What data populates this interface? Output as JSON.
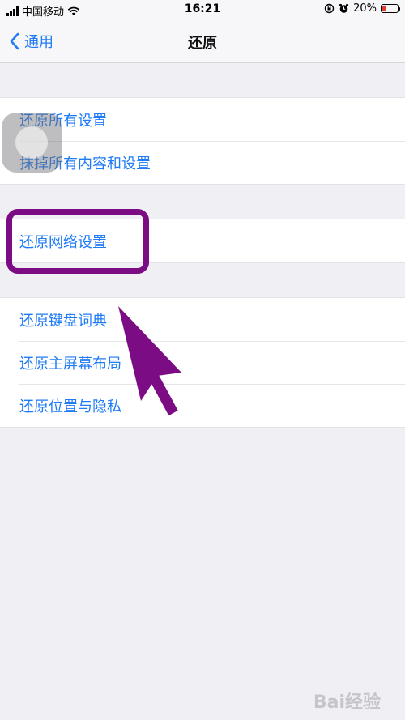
{
  "status_bar": {
    "carrier": "中国移动",
    "time": "16:21",
    "battery_percent": "20%",
    "battery_level": 0.2,
    "icons": [
      "signal-icon",
      "wifi-icon",
      "orientation-lock-icon",
      "alarm-icon",
      "battery-icon"
    ]
  },
  "nav": {
    "back_label": "通用",
    "title": "还原"
  },
  "groups": [
    [
      "还原所有设置",
      "抹掉所有内容和设置"
    ],
    [
      "还原网络设置"
    ],
    [
      "还原键盘词典",
      "还原主屏幕布局",
      "还原位置与隐私"
    ]
  ],
  "annotation": {
    "highlight_color": "#7b0c84",
    "arrow_color": "#7b0c84"
  },
  "watermark": {
    "text": "Bai经验"
  },
  "colors": {
    "accent": "#1f7bf6",
    "background": "#efeff4"
  }
}
